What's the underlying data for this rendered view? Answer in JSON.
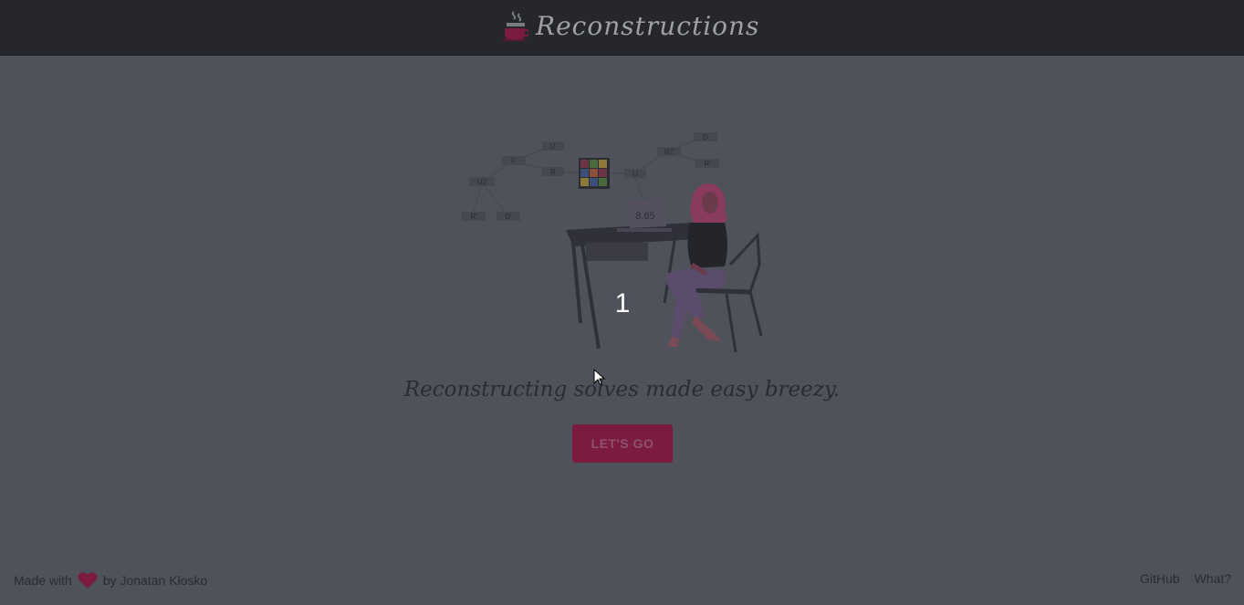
{
  "header": {
    "title": "Reconstructions",
    "logo_icon": "coffee-cup-icon"
  },
  "hero": {
    "timer_display": "8.65",
    "move_labels": [
      "U'",
      "F",
      "R",
      "U2",
      "R'",
      "D'",
      "U",
      "R2",
      "D",
      "R'"
    ],
    "countdown": "1"
  },
  "main": {
    "tagline": "Reconstructing solves made easy breezy.",
    "cta_label": "LET'S GO"
  },
  "footer": {
    "made_with": "Made with",
    "heart_icon": "heart-icon",
    "author": "by Jonatan Kłosko",
    "github_label": "GitHub",
    "what_label": "What?"
  },
  "colors": {
    "accent": "#7b1b3f",
    "header_bg": "#25272d",
    "page_bg": "#50525b"
  }
}
